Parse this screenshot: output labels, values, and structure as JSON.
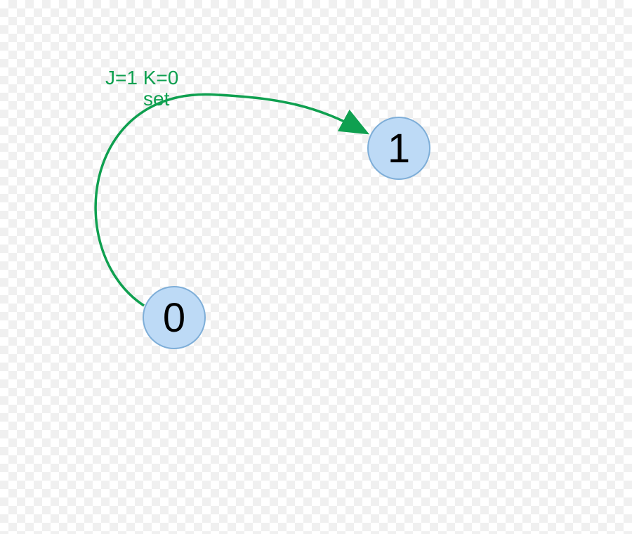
{
  "diagram": {
    "type": "state-transition",
    "states": {
      "state_0": {
        "label": "0",
        "fill_color": "#bddaf6",
        "border_color": "#7eaed8"
      },
      "state_1": {
        "label": "1",
        "fill_color": "#bddaf6",
        "border_color": "#7eaed8"
      }
    },
    "transitions": {
      "set": {
        "from": "0",
        "to": "1",
        "condition": "J=1 K=0",
        "action": "set",
        "color": "#0fa050"
      }
    }
  }
}
